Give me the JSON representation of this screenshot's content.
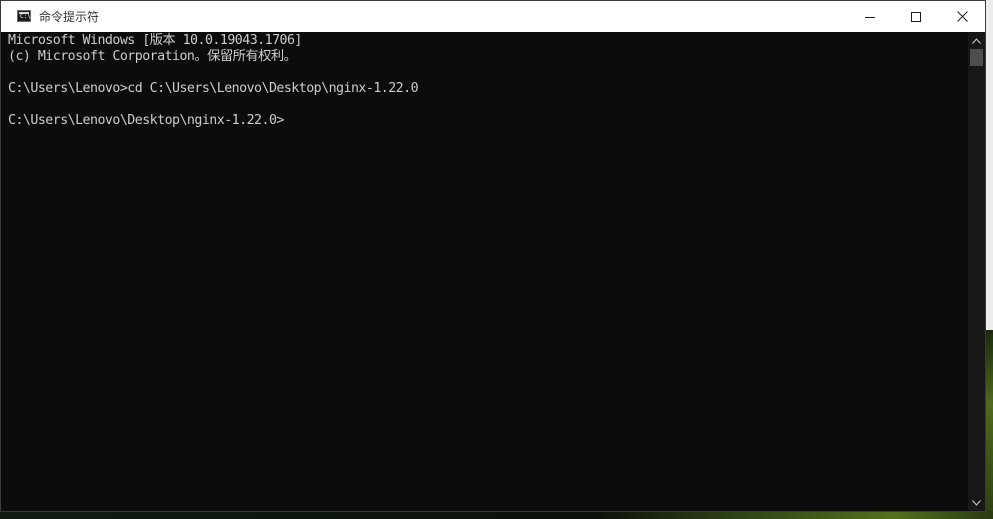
{
  "window": {
    "title": "命令提示符",
    "icon": "cmd-icon",
    "icon_glyph": "C:\\"
  },
  "console": {
    "lines": [
      "Microsoft Windows [版本 10.0.19043.1706]",
      "(c) Microsoft Corporation。保留所有权利。",
      "C:\\Users\\Lenovo>cd C:\\Users\\Lenovo\\Desktop\\nginx-1.22.0",
      "C:\\Users\\Lenovo\\Desktop\\nginx-1.22.0>"
    ]
  },
  "caption_buttons": {
    "minimize": "minimize-icon",
    "maximize": "maximize-icon",
    "close": "close-icon"
  },
  "colors": {
    "console_bg": "#0c0c0c",
    "console_text": "#cccccc",
    "titlebar_bg": "#ffffff"
  }
}
